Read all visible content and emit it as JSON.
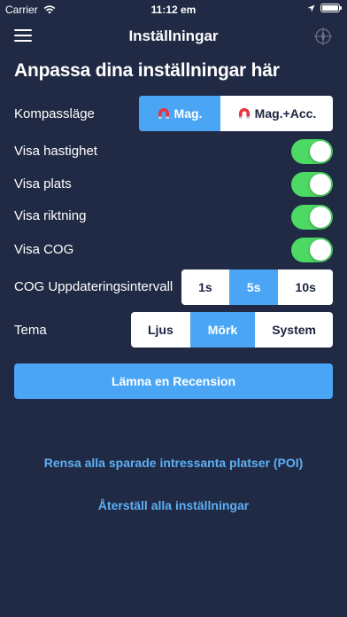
{
  "status_bar": {
    "carrier": "Carrier",
    "time": "11:12 em"
  },
  "nav": {
    "title": "Inställningar",
    "menu_icon": "hamburger-icon",
    "compass_icon": "compass-icon"
  },
  "heading": "Anpassa dina inställningar här",
  "compass_mode": {
    "label": "Kompassläge",
    "options": [
      "Mag.",
      "Mag.+Acc."
    ],
    "selected": "Mag."
  },
  "toggles": {
    "speed": {
      "label": "Visa hastighet",
      "on": true
    },
    "position": {
      "label": "Visa plats",
      "on": true
    },
    "direction": {
      "label": "Visa riktning",
      "on": true
    },
    "cog": {
      "label": "Visa COG",
      "on": true
    }
  },
  "cog_interval": {
    "label": "COG Uppdateringsintervall",
    "options": [
      "1s",
      "5s",
      "10s"
    ],
    "selected": "5s"
  },
  "theme": {
    "label": "Tema",
    "options": [
      "Ljus",
      "Mörk",
      "System"
    ],
    "selected": "Mörk"
  },
  "review_button": "Lämna en Recension",
  "clear_poi_link": "Rensa alla sparade intressanta platser (POI)",
  "reset_link": "Återställ alla inställningar",
  "colors": {
    "background": "#202a44",
    "accent": "#4aa6f5",
    "toggle_on": "#4cd964",
    "link": "#5db0f6"
  }
}
